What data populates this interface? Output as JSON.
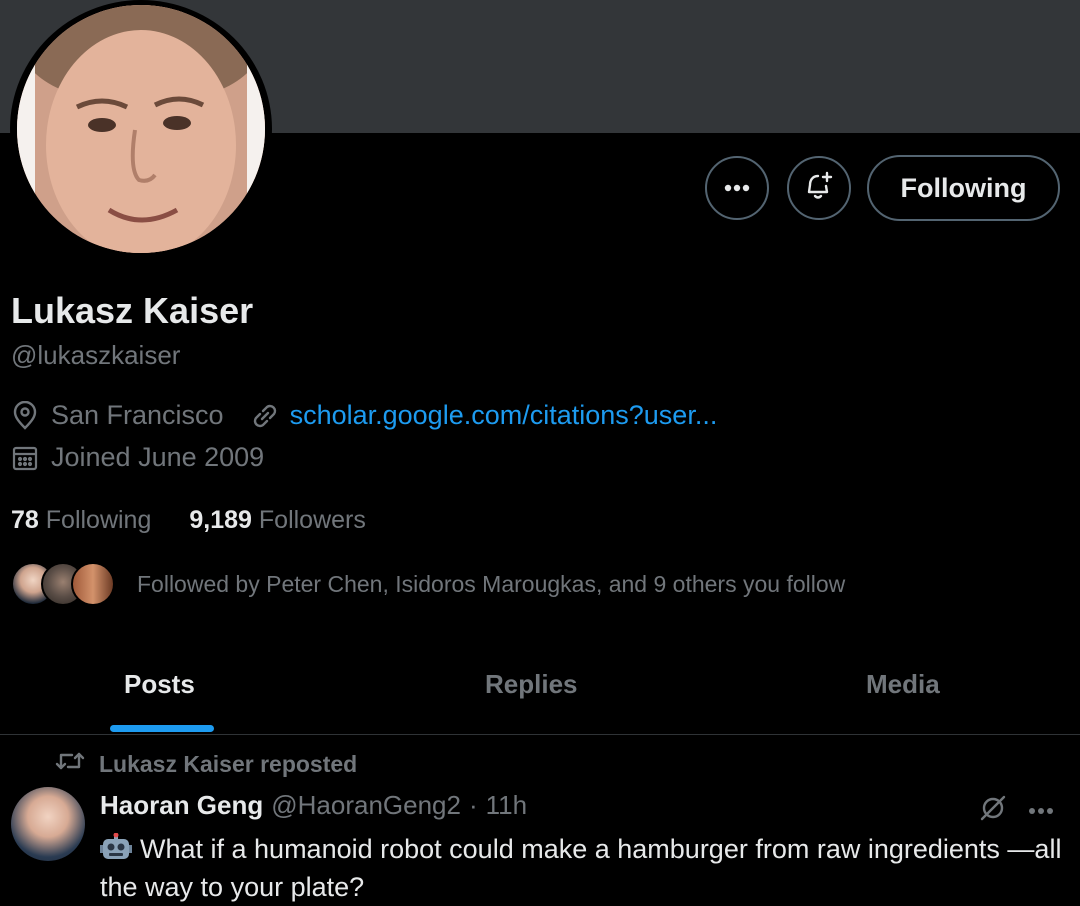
{
  "profile": {
    "name": "Lukasz Kaiser",
    "handle": "@lukaszkaiser",
    "location": "San Francisco",
    "link": "scholar.google.com/citations?user...",
    "joined": "Joined June 2009",
    "following_count": "78",
    "following_label": "Following",
    "followers_count": "9,189",
    "followers_label": "Followers",
    "followed_by": "Followed by Peter Chen, Isidoros Marougkas, and 9 others you follow"
  },
  "actions": {
    "more_icon": "more-icon",
    "notify_icon": "bell-plus-icon",
    "follow_button": "Following"
  },
  "tabs": [
    {
      "label": "Posts",
      "active": true
    },
    {
      "label": "Replies",
      "active": false
    },
    {
      "label": "Media",
      "active": false
    }
  ],
  "post": {
    "repost_label": "Lukasz Kaiser reposted",
    "author": "Haoran Geng",
    "handle": "@HaoranGeng2",
    "separator": "·",
    "time": "11h",
    "text": "What if a humanoid robot could make a hamburger from raw ingredients —all the way to your plate?",
    "emoji_icon": "robot-emoji-icon"
  },
  "colors": {
    "background": "#000000",
    "banner": "#333639",
    "accent": "#1d9bf0",
    "muted": "#71767b",
    "text": "#e7e9ea"
  }
}
